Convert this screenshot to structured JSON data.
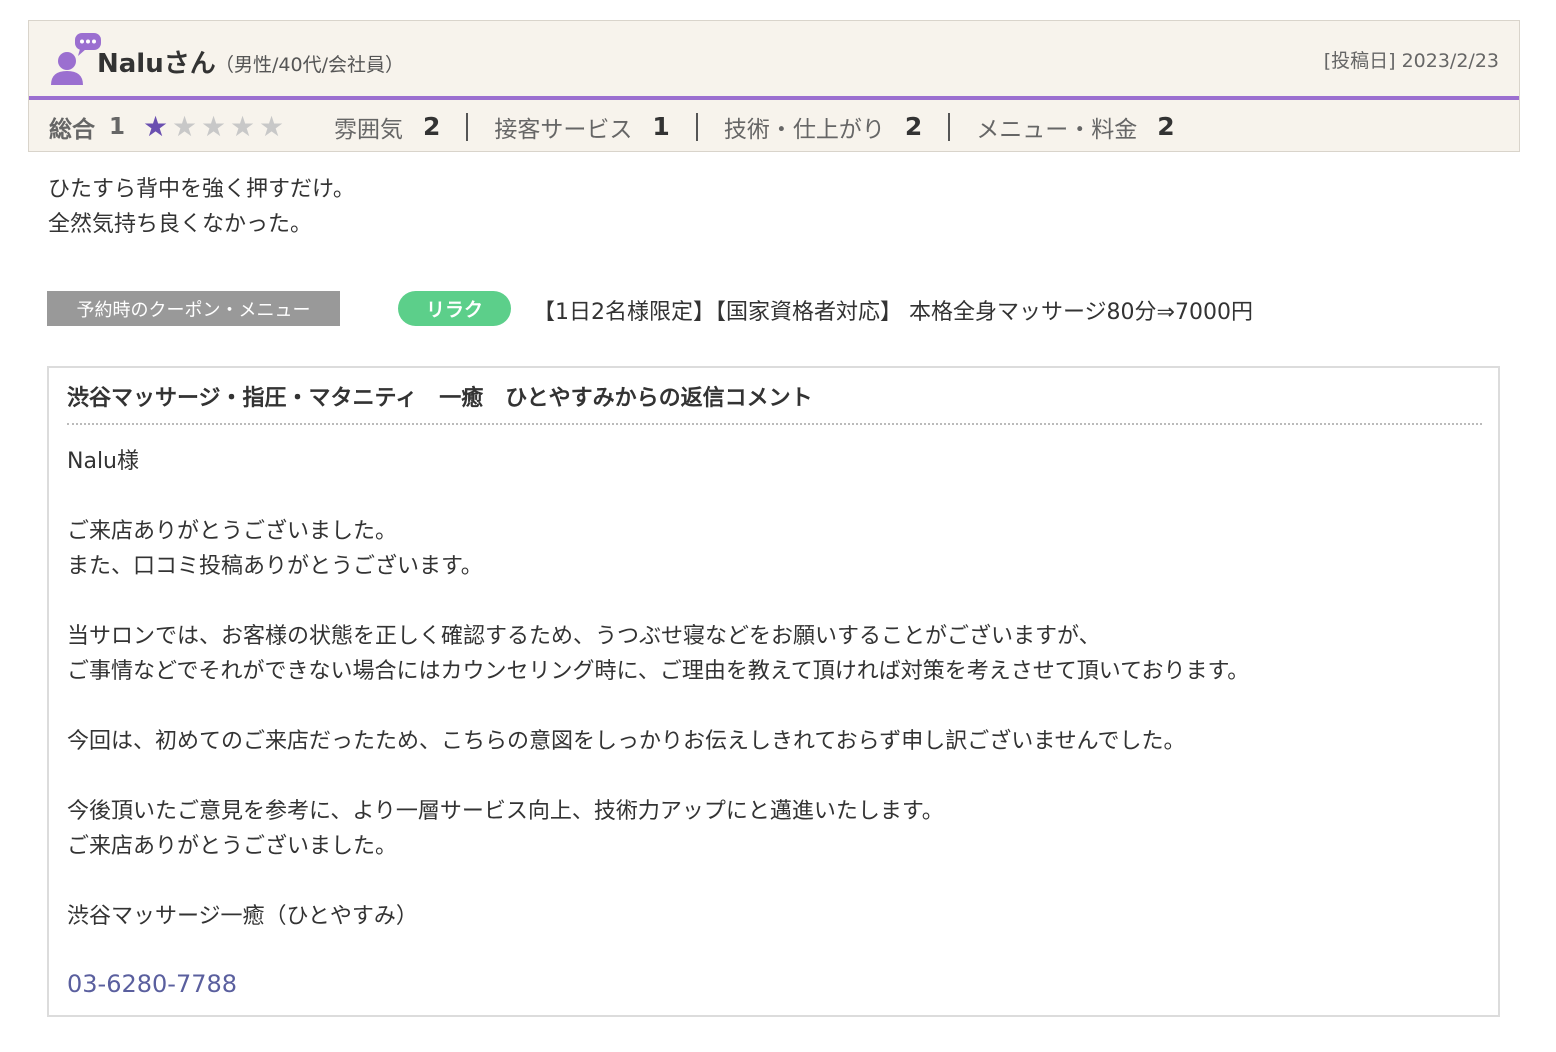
{
  "review": {
    "username": "Naluさん",
    "attributes": "（男性/40代/会社員）",
    "post_date": "[投稿日] 2023/2/23",
    "overall_label": "総合",
    "overall_value": "1",
    "star_rating": 1,
    "star_max": 5,
    "categories": [
      {
        "label": "雰囲気",
        "value": "2"
      },
      {
        "label": "接客サービス",
        "value": "1"
      },
      {
        "label": "技術・仕上がり",
        "value": "2"
      },
      {
        "label": "メニュー・料金",
        "value": "2"
      }
    ],
    "body_lines": [
      "ひたすら背中を強く押すだけ。",
      "全然気持ち良くなかった。"
    ]
  },
  "coupon": {
    "label": "予約時のクーポン・メニュー",
    "badge": "リラク",
    "text": "【1日2名様限定】【国家資格者対応】 本格全身マッサージ80分⇒7000円"
  },
  "reply": {
    "title": "渋谷マッサージ・指圧・マタニティ　一癒　ひとやすみからの返信コメント",
    "lines": [
      "Nalu様",
      "",
      "ご来店ありがとうございました。",
      "また、口コミ投稿ありがとうございます。",
      "",
      "当サロンでは、お客様の状態を正しく確認するため、うつぶせ寝などをお願いすることがございますが、",
      "ご事情などでそれができない場合にはカウンセリング時に、ご理由を教えて頂ければ対策を考えさせて頂いております。",
      "",
      "今回は、初めてのご来店だったため、こちらの意図をしっかりお伝えしきれておらず申し訳ございませんでした。",
      "",
      "今後頂いたご意見を参考に、より一層サービス向上、技術力アップにと邁進いたします。",
      "ご来店ありがとうございました。",
      "",
      "渋谷マッサージ一癒（ひとやすみ）"
    ],
    "phone": "03-6280-7788"
  },
  "colors": {
    "accent_purple": "#9b6fd0",
    "star_on": "#6a4fb0",
    "relax_green": "#5ccf8a",
    "phone_link": "#5a5f9e"
  }
}
